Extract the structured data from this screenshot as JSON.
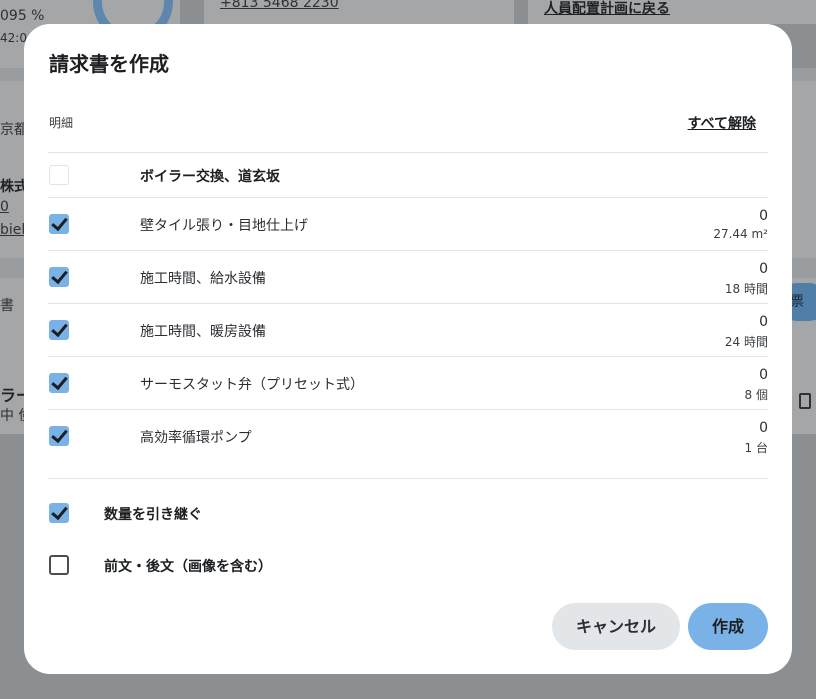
{
  "background": {
    "percent": "095 %",
    "time": "42:0",
    "phone": "+813 5468 2230",
    "back_link": "人員配置計画に戻る",
    "address_fragment": "京都",
    "company_fragment": "株式",
    "number_fragment": "0",
    "email_fragment": "biel.",
    "tab_fragment": "書",
    "pill_fragment": "票",
    "row_title_fragment": "ラー",
    "row_sub_fragment": "中 倹"
  },
  "modal": {
    "title": "請求書を作成",
    "section_label": "明細",
    "clear_all": "すべて解除",
    "group": {
      "label": "ボイラー交換、道玄坂",
      "checked": false
    },
    "items": [
      {
        "label": "壁タイル張り・目地仕上げ",
        "price": "0",
        "qty": "27.44 m²",
        "checked": true
      },
      {
        "label": "施工時間、給水設備",
        "price": "0",
        "qty": "18 時間",
        "checked": true
      },
      {
        "label": "施工時間、暖房設備",
        "price": "0",
        "qty": "24 時間",
        "checked": true
      },
      {
        "label": "サーモスタット弁（プリセット式）",
        "price": "0",
        "qty": "8 個",
        "checked": true
      },
      {
        "label": "高効率循環ポンプ",
        "price": "0",
        "qty": "1 台",
        "checked": true
      }
    ],
    "options": [
      {
        "label": "数量を引き継ぐ",
        "checked": true
      },
      {
        "label": "前文・後文（画像を含む）",
        "checked": false
      }
    ],
    "cancel_label": "キャンセル",
    "create_label": "作成"
  },
  "colors": {
    "accent": "#7ab1e6",
    "overlay": "#8c8f92"
  }
}
